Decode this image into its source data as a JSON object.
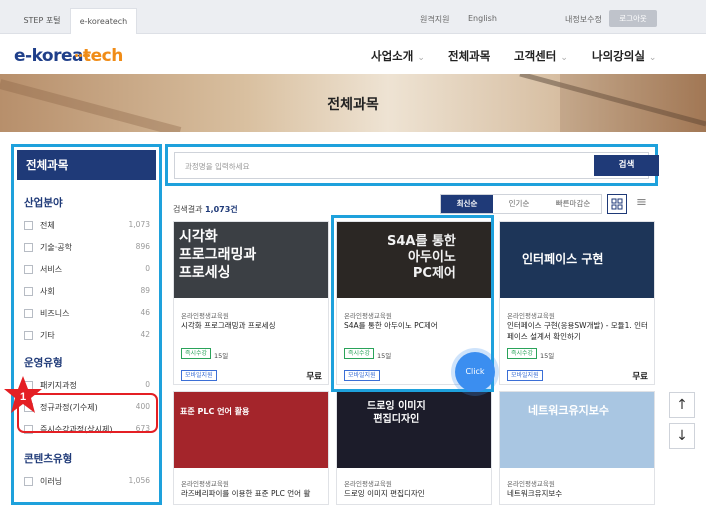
{
  "topbar": {
    "tabs": [
      "STEP 포털",
      "e-koreatech"
    ],
    "links": [
      "원격지원",
      "English",
      "내정보수정"
    ],
    "login": "로그아웃"
  },
  "header": {
    "logo_main": "e-korea",
    "logo_accent": "tech",
    "nav": [
      "사업소개",
      "전체과목",
      "고객센터",
      "나의강의실"
    ]
  },
  "banner": {
    "title": "전체과목"
  },
  "sidebar": {
    "title": "전체과목",
    "sections": [
      {
        "title": "산업분야",
        "items": [
          {
            "label": "전체",
            "count": "1,073"
          },
          {
            "label": "기술·공학",
            "count": "896"
          },
          {
            "label": "서비스",
            "count": "0"
          },
          {
            "label": "사회",
            "count": "89"
          },
          {
            "label": "비즈니스",
            "count": "46"
          },
          {
            "label": "기타",
            "count": "42"
          }
        ]
      },
      {
        "title": "운영유형",
        "items": [
          {
            "label": "패키지과정",
            "count": "0"
          },
          {
            "label": "정규과정(기수제)",
            "count": "400"
          },
          {
            "label": "즉시수강과정(상시제)",
            "count": "673"
          }
        ]
      },
      {
        "title": "콘텐츠유형",
        "items": [
          {
            "label": "이러닝",
            "count": "1,056"
          }
        ]
      }
    ]
  },
  "search": {
    "placeholder": "과정명을 입력하세요",
    "button": "검색"
  },
  "results": {
    "label": "검색결과",
    "count": "1,073건"
  },
  "sort": [
    "최신순",
    "인기순",
    "빠른마감순"
  ],
  "cards": [
    {
      "thumb_text": "시각화\n프로그래밍과\n프로세싱",
      "org": "온라인평생교육원",
      "title": "시각화 프로그래밍과 프로세싱",
      "tag": "즉시수강",
      "days": "15일",
      "mobile": "모바일지원",
      "price": "무료"
    },
    {
      "thumb_text": "S4A를 통한\n아두이노\nPC제어",
      "org": "온라인평생교육원",
      "title": "S4A를 통한 아두이노 PC제어",
      "tag": "즉시수강",
      "days": "15일",
      "mobile": "모바일지원",
      "price": "무료"
    },
    {
      "thumb_text": "인터페이스 구현",
      "org": "온라인평생교육원",
      "title": "인터페이스 구현(응용SW개발) - 모듈1. 인터페이스 설계서 확인하기",
      "tag": "즉시수강",
      "days": "15일",
      "mobile": "모바일지원",
      "price": "무료"
    },
    {
      "thumb_text": "표준 PLC 언어 활용",
      "org": "온라인평생교육원",
      "title": "라즈베리파이를 이용한 표준 PLC 언어 활"
    },
    {
      "thumb_text": "드로잉 이미지\n편집디자인",
      "org": "온라인평생교육원",
      "title": "드로잉 이미지 편집디자인"
    },
    {
      "thumb_text": "네트워크유지보수",
      "org": "온라인평생교육원",
      "title": "네트워크유지보수"
    }
  ],
  "click_label": "Click",
  "annotation_number": "1",
  "scroll": {
    "up": "↑",
    "down": "↓"
  }
}
